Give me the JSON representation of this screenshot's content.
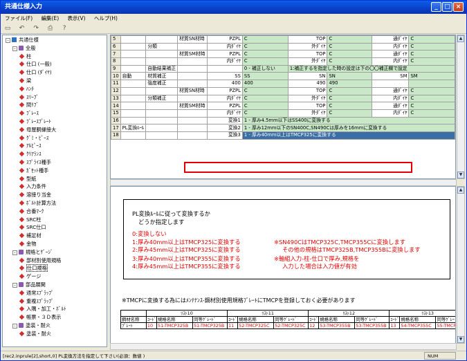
{
  "window": {
    "title": "共通仕様入力"
  },
  "menu": [
    "ファイル(F)",
    "編集(E)",
    "表示(V)",
    "ヘルプ(H)"
  ],
  "tree": [
    {
      "label": "共通仕様",
      "lvl": 0,
      "pm": "-",
      "ic": "book"
    },
    {
      "label": "全般",
      "lvl": 1,
      "pm": "-",
      "ic": "folder"
    },
    {
      "label": "柱",
      "lvl": 2,
      "ic": "dia"
    },
    {
      "label": "仕口 (一般)",
      "lvl": 2,
      "ic": "dia"
    },
    {
      "label": "仕口 (ﾀﾞｲﾔ)",
      "lvl": 2,
      "ic": "dia"
    },
    {
      "label": "梁",
      "lvl": 2,
      "ic": "dia"
    },
    {
      "label": "ﾊﾝﾁ",
      "lvl": 2,
      "ic": "dia"
    },
    {
      "label": "ｽﾘｰﾌﾞ",
      "lvl": 2,
      "ic": "dia"
    },
    {
      "label": "間ﾘﾌﾞ",
      "lvl": 2,
      "ic": "dia"
    },
    {
      "label": "ﾌﾞﾚｰｽ",
      "lvl": 2,
      "ic": "dia"
    },
    {
      "label": "ﾌﾞﾚｰｽﾌﾟﾚｰﾄ",
      "lvl": 2,
      "ic": "dia"
    },
    {
      "label": "母屋胴縁接大",
      "lvl": 2,
      "ic": "dia"
    },
    {
      "label": "ｸﾞﾐ・ﾋﾟｰｽ",
      "lvl": 2,
      "ic": "dia"
    },
    {
      "label": "ｱﾙﾋﾟｰｽ",
      "lvl": 2,
      "ic": "dia"
    },
    {
      "label": "ｸﾘｱﾗﾝｽ",
      "lvl": 2,
      "ic": "dia"
    },
    {
      "label": "ｽﾌﾟﾗｲｽ種手",
      "lvl": 2,
      "ic": "dia"
    },
    {
      "label": "ｶﾞｾｯﾄ種手",
      "lvl": 2,
      "ic": "dia"
    },
    {
      "label": "型紙",
      "lvl": 2,
      "ic": "dia"
    },
    {
      "label": "入力条件",
      "lvl": 2,
      "ic": "dia"
    },
    {
      "label": "溶接り当金",
      "lvl": 2,
      "ic": "dia"
    },
    {
      "label": "ﾎﾞﾙﾄ計算方法",
      "lvl": 2,
      "ic": "dia"
    },
    {
      "label": "合番ﾏｰｸ",
      "lvl": 2,
      "ic": "dia"
    },
    {
      "label": "SRC柱",
      "lvl": 2,
      "ic": "dia"
    },
    {
      "label": "SRC仕口",
      "lvl": 2,
      "ic": "dia"
    },
    {
      "label": "補足材",
      "lvl": 2,
      "ic": "dia"
    },
    {
      "label": "金物",
      "lvl": 2,
      "ic": "dia"
    },
    {
      "label": "規格とｹﾞｰｼﾞ",
      "lvl": 1,
      "pm": "-",
      "ic": "folder"
    },
    {
      "label": "部材別使用規格",
      "lvl": 2,
      "ic": "dia"
    },
    {
      "label": "仕口規格",
      "lvl": 2,
      "ic": "dia",
      "sel": true
    },
    {
      "label": "ゲージ",
      "lvl": 2,
      "ic": "dia"
    },
    {
      "label": "部品展開",
      "lvl": 1,
      "pm": "-",
      "ic": "folder"
    },
    {
      "label": "通常ｽﾌﾟﾗｯﾌﾟ",
      "lvl": 2,
      "ic": "dia"
    },
    {
      "label": "重複ｽﾌﾟﾗｯﾌﾟ",
      "lvl": 2,
      "ic": "dia"
    },
    {
      "label": "入隅・加工・ﾎﾞﾙﾄ",
      "lvl": 2,
      "ic": "dia"
    },
    {
      "label": "帳票・３Ｄ表示",
      "lvl": 2,
      "ic": "dia"
    },
    {
      "label": "塗装・耐火",
      "lvl": 1,
      "pm": "-",
      "ic": "folder"
    },
    {
      "label": "塗装・耐火",
      "lvl": 2,
      "ic": "dia"
    }
  ],
  "grid": [
    [
      "5",
      "",
      "",
      "材質SN材時",
      "PZPL",
      "C",
      "TOP",
      "C",
      "通ﾀﾞｲﾔ",
      "C"
    ],
    [
      "6",
      "",
      "分類",
      "",
      "内ﾀﾞｲﾔ",
      "C",
      "外ﾀﾞｲﾔ",
      "C",
      "内ﾀﾞｲﾔ",
      "C"
    ],
    [
      "7",
      "",
      "",
      "材質SM材時",
      "PZPL",
      "C",
      "TOP",
      "C",
      "通ﾀﾞｲﾔ",
      "C"
    ],
    [
      "8",
      "",
      "",
      "",
      "内ﾀﾞｲﾔ",
      "C",
      "外ﾀﾞｲﾔ",
      "C",
      "内ﾀﾞｲﾔ",
      "C"
    ],
    [
      "9",
      "",
      "自動結果補正",
      "",
      "",
      "0 - 補正しない",
      "1:補正するを指定した時の設定は下の〇〇補正欄で設定",
      "",
      "",
      ""
    ],
    [
      "10",
      "自動",
      "材質補正",
      "",
      "SS",
      "SS",
      "SN",
      "SN",
      "SM",
      "SM"
    ],
    [
      "11",
      "",
      "強度補正",
      "",
      "400",
      "400",
      "490",
      "490",
      "",
      ""
    ],
    [
      "12",
      "",
      "",
      "材質SN材時",
      "PZPL",
      "C",
      "TOP",
      "C",
      "通ﾀﾞｲﾔ",
      "C"
    ],
    [
      "13",
      "",
      "分類補正",
      "",
      "内ﾀﾞｲﾔ",
      "C",
      "外ﾀﾞｲﾔ",
      "C",
      "内ﾀﾞｲﾔ",
      "C"
    ],
    [
      "14",
      "",
      "",
      "材質SM材時",
      "PZPL",
      "C",
      "TOP",
      "C",
      "通ﾀﾞｲﾔ",
      "C"
    ],
    [
      "15",
      "",
      "",
      "",
      "内ﾀﾞｲﾔ",
      "C",
      "外ﾀﾞｲﾔ",
      "C",
      "内ﾀﾞｲﾔ",
      "C"
    ],
    [
      "16",
      "",
      "",
      "",
      "変換1",
      "1 - 厚み4.5mm以下はSS400に変換する",
      "",
      "",
      "",
      ""
    ],
    [
      "17",
      "PL変換ﾙｰﾙ",
      "",
      "",
      "変換2",
      "1 - 厚み12mm以下のSN400C,SN490Cは厚みを16mmに変換する",
      "",
      "",
      "",
      ""
    ],
    [
      "18",
      "",
      "",
      "",
      "変換3",
      "1 - 厚み40mm以上はTMCP325に変換する",
      "",
      "",
      "",
      ""
    ]
  ],
  "doc": {
    "l1": "PL変換ﾙｰﾙに従って変換するか",
    "l2": "どうか指定します",
    "o0": "0:変換しない",
    "o1": "1:厚み40mm以上はTMCP325に変換する",
    "o2": "2:厚み45mm以上はTMCP325に変換する",
    "o3": "3:厚み40mm以上はTMCP355に変換する",
    "o4": "4:厚み45mm以上はTMCP355に変換する",
    "n1": "※SN490CはTMCP325C,TMCP355Cに変換します",
    "n2": "その他の規格はTMCP325B,TMCP355Bに変換します",
    "n3": "※軸組入力-柱-仕口で厚み,規格を",
    "n4": "入力した場合は入力値が有効",
    "bottom": "※TMCPに変換する為にはﾒﾝﾃﾅﾝｽ-鋼材別使用規格ﾌﾞﾚｰﾄにTMCPを登録しておく必要があります",
    "tgroups": [
      "ﾘｽﾄ10",
      "ﾘｽﾄ11",
      "ﾘｽﾄ12",
      "ﾘｽﾄ13"
    ],
    "thead": [
      "鋼材名称",
      "ｺｰﾄﾞ",
      "規格名称",
      "同等ｸﾞﾚｰﾄﾞ",
      "ｺｰﾄﾞ",
      "規格名称",
      "同等ｸﾞﾚｰﾄﾞ",
      "ｺｰﾄﾞ",
      "規格名称",
      "同等ｸﾞﾚｰﾄﾞ",
      "ｺｰﾄﾞ",
      "規格名称",
      "同等ｸﾞﾚｰ"
    ],
    "trow": [
      "ﾌﾟﾚｰﾄ",
      "10",
      "51-TMCP325B",
      "51-TMCP325B",
      "11",
      "52-TMCP325C",
      "52-TMCP325C",
      "12",
      "53-TMCP355B",
      "53-TMCP355B",
      "13",
      "54-TMCP355C",
      "55-TMCP35"
    ]
  },
  "status": {
    "text": "[rec2.inprule[2],short,0] PL変換方法を指定して下さい(必須：数値 )",
    "num": "NUM"
  }
}
